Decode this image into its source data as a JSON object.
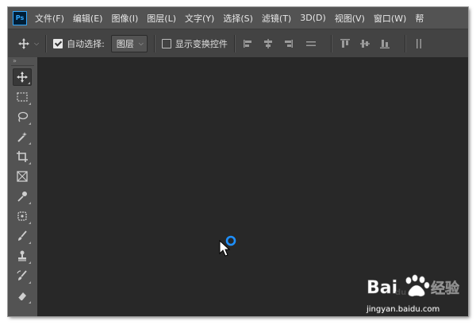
{
  "app": {
    "logo_text": "Ps"
  },
  "menu": [
    "文件(F)",
    "编辑(E)",
    "图像(I)",
    "图层(L)",
    "文字(Y)",
    "选择(S)",
    "滤镜(T)",
    "3D(D)",
    "视图(V)",
    "窗口(W)",
    "帮"
  ],
  "options": {
    "auto_select_label": "自动选择:",
    "auto_select_checked": true,
    "auto_select_target": "图层",
    "show_transform_label": "显示变换控件",
    "show_transform_checked": false
  },
  "tools": [
    {
      "name": "move-tool-icon",
      "active": true
    },
    {
      "name": "marquee-tool-icon"
    },
    {
      "name": "lasso-tool-icon"
    },
    {
      "name": "magic-wand-tool-icon"
    },
    {
      "name": "crop-tool-icon"
    },
    {
      "name": "frame-tool-icon"
    },
    {
      "name": "eyedropper-tool-icon"
    },
    {
      "name": "healing-brush-tool-icon"
    },
    {
      "name": "brush-tool-icon"
    },
    {
      "name": "clone-stamp-tool-icon"
    },
    {
      "name": "history-brush-tool-icon"
    },
    {
      "name": "eraser-tool-icon"
    }
  ],
  "watermark": {
    "brand_text": "Baidu经验",
    "url_text": "jingyan.baidu.com"
  },
  "colors": {
    "menubar_bg": "#535353",
    "options_bg": "#434343",
    "workspace_bg": "#282828",
    "busy_indicator": "#1e90ff",
    "ps_logo_accent": "#31a8ff"
  }
}
